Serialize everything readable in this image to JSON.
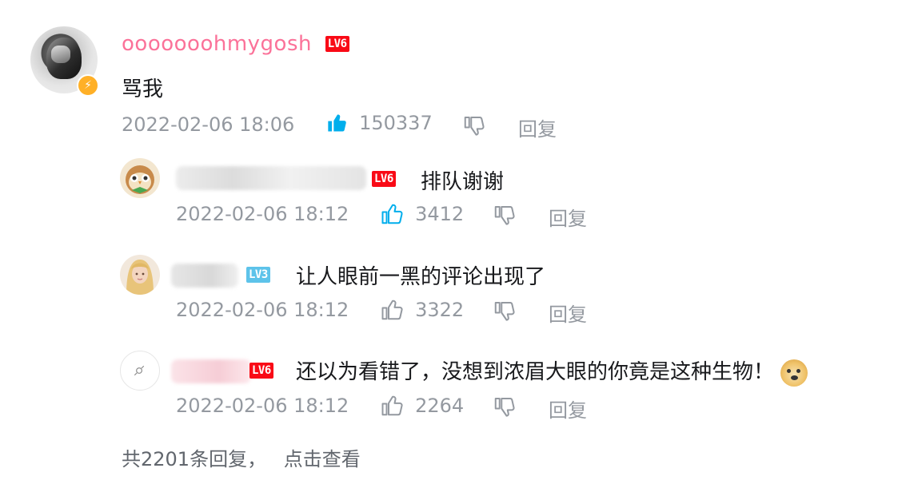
{
  "main_comment": {
    "username": "ooooooohmygosh",
    "level": "LV6",
    "content": "骂我",
    "time": "2022-02-06 18:06",
    "likes": "150337",
    "reply_label": "回复",
    "liked": true
  },
  "replies": [
    {
      "level": "LV6",
      "content": "排队谢谢",
      "time": "2022-02-06 18:12",
      "likes": "3412",
      "reply_label": "回复"
    },
    {
      "level": "LV3",
      "content": "让人眼前一黑的评论出现了",
      "time": "2022-02-06 18:12",
      "likes": "3322",
      "reply_label": "回复"
    },
    {
      "level": "LV6",
      "content": "还以为看错了，没想到浓眉大眼的你竟是这种生物！",
      "time": "2022-02-06 18:12",
      "likes": "2264",
      "reply_label": "回复",
      "emoji": "doge-emoji"
    }
  ],
  "footer": {
    "summary": "共2201条回复，",
    "view_link": "点击查看"
  },
  "colors": {
    "username_pink": "#fb7299",
    "like_active_blue": "#00aeec",
    "meta_gray": "#9499a0",
    "lv6_red": "#f90a16",
    "lv3_blue": "#5dc3ea"
  }
}
